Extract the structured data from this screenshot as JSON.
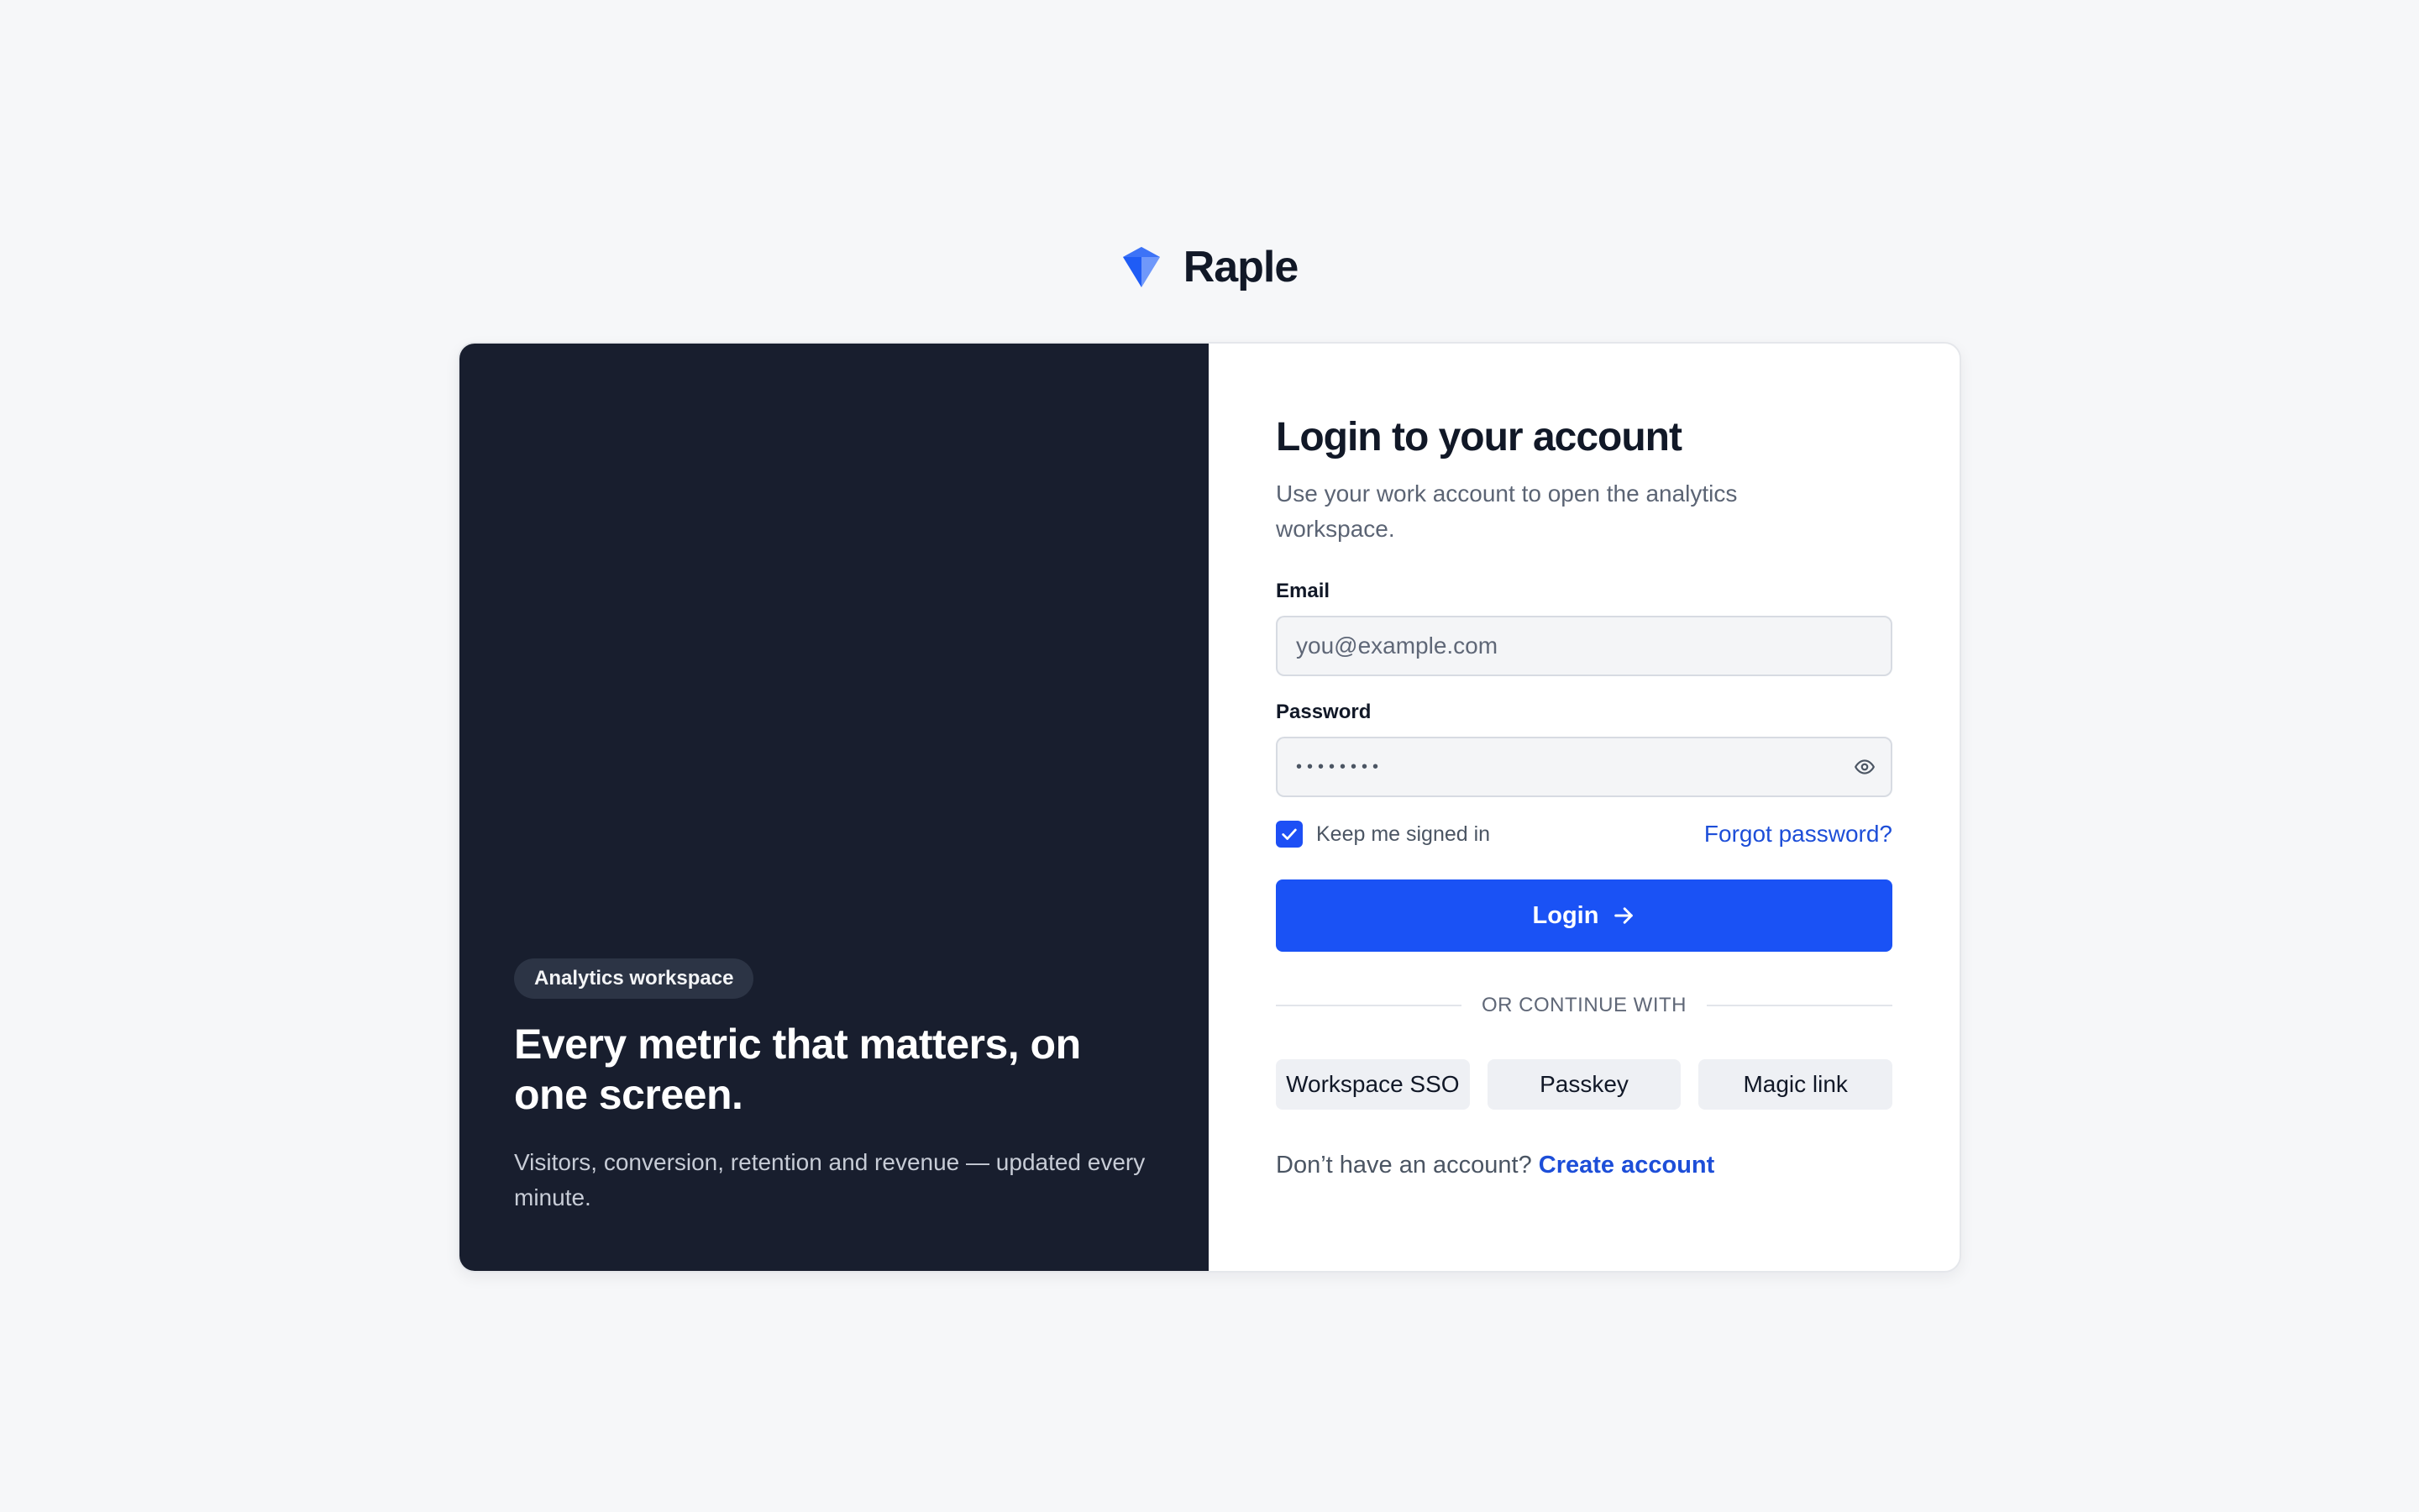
{
  "brand": {
    "name": "Raple",
    "logo_icon": "diamond-gem-icon",
    "logo_colors": [
      "#1f5cf5",
      "#3d73f7",
      "#82a8fb"
    ]
  },
  "hero": {
    "badge": "Analytics workspace",
    "title": "Every metric that matters, on one screen.",
    "subtitle": "Visitors, conversion, retention and revenue — updated every minute.",
    "background_color": "#181e2e"
  },
  "form": {
    "title": "Login to your account",
    "subtitle": "Use your work account to open the analytics workspace.",
    "email": {
      "label": "Email",
      "placeholder": "you@example.com",
      "value": ""
    },
    "password": {
      "label": "Password",
      "value": "••••••••",
      "toggle_icon": "eye-icon"
    },
    "remember": {
      "label": "Keep me signed in",
      "checked": true
    },
    "forgot_label": "Forgot password?",
    "login_label": "Login",
    "login_icon": "arrow-right-icon",
    "divider_label": "OR CONTINUE WITH",
    "alt_options": [
      "Workspace SSO",
      "Passkey",
      "Magic link"
    ],
    "signup_prompt": "Don’t have an account?",
    "signup_label": "Create account"
  },
  "colors": {
    "primary": "#1a52f5",
    "link": "#1d4ed8",
    "page_background": "#f6f7f9"
  }
}
